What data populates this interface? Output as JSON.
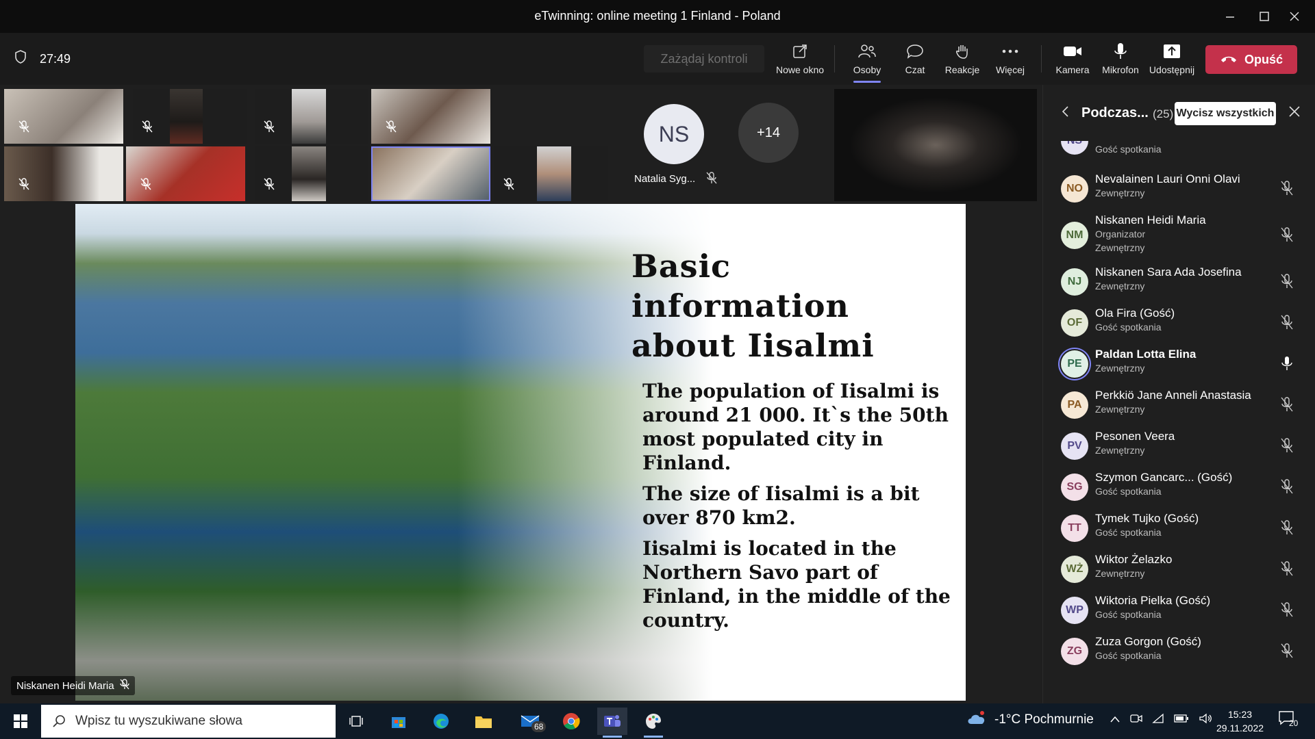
{
  "window": {
    "title": "eTwinning: online meeting 1 Finland - Poland"
  },
  "toolbar": {
    "timer": "27:49",
    "request_control": "Zażądaj kontroli",
    "new_window": "Nowe okno",
    "people": "Osoby",
    "chat": "Czat",
    "reactions": "Reakcje",
    "more": "Więcej",
    "camera": "Kamera",
    "mic": "Mikrofon",
    "share": "Udostępnij",
    "leave": "Opuść"
  },
  "gallery": {
    "ns_initials": "NS",
    "ns_name": "Natalia Syg...",
    "overflow": "+14"
  },
  "slide": {
    "title": "Basic information about Iisalmi",
    "paragraphs": [
      "The population of Iisalmi is around 21 000. It`s the 50th most populated city in Finland.",
      "The size of Iisalmi is a bit over 870 km2.",
      "Iisalmi is located in the Northern Savo part of Finland, in the middle of the country."
    ]
  },
  "presenter": {
    "name": "Niskanen Heidi Maria"
  },
  "panel": {
    "title": "Podczas...",
    "count": "(25)",
    "mute_all": "Wycisz wszystkich",
    "participants": [
      {
        "initials": "NO",
        "name": "Nevalainen Lauri Onni Olavi",
        "role": "Zewnętrzny",
        "role2": "",
        "bg": "#f5e6d3",
        "fg": "#8a5a23"
      },
      {
        "initials": "NM",
        "name": "Niskanen Heidi Maria",
        "role": "Organizator",
        "role2": "Zewnętrzny",
        "bg": "#e3eedc",
        "fg": "#4e6b3a"
      },
      {
        "initials": "NJ",
        "name": "Niskanen Sara Ada Josefina",
        "role": "Zewnętrzny",
        "role2": "",
        "bg": "#dfeede",
        "fg": "#3f6b3d"
      },
      {
        "initials": "OF",
        "name": "Ola Fira (Gość)",
        "role": "Gość spotkania",
        "role2": "",
        "bg": "#e5ead9",
        "fg": "#5b6b36"
      },
      {
        "initials": "PE",
        "name": "Paldan Lotta Elina",
        "role": "Zewnętrzny",
        "role2": "",
        "bg": "#e0f0e6",
        "fg": "#2f6b4d"
      },
      {
        "initials": "PA",
        "name": "Perkkiö Jane Anneli Anastasia",
        "role": "Zewnętrzny",
        "role2": "",
        "bg": "#f6e8d5",
        "fg": "#8a5a23"
      },
      {
        "initials": "PV",
        "name": "Pesonen Veera",
        "role": "Zewnętrzny",
        "role2": "",
        "bg": "#e6e3f3",
        "fg": "#534a8a"
      },
      {
        "initials": "SG",
        "name": "Szymon Gancarc... (Gość)",
        "role": "Gość spotkania",
        "role2": "",
        "bg": "#f3e0e8",
        "fg": "#8a3f5e"
      },
      {
        "initials": "TT",
        "name": "Tymek Tujko (Gość)",
        "role": "Gość spotkania",
        "role2": "",
        "bg": "#f3e0e8",
        "fg": "#8a3f5e"
      },
      {
        "initials": "WŻ",
        "name": "Wiktor Żelazko",
        "role": "Zewnętrzny",
        "role2": "",
        "bg": "#e5ead9",
        "fg": "#5b6b36"
      },
      {
        "initials": "WP",
        "name": "Wiktoria Pielka (Gość)",
        "role": "Gość spotkania",
        "role2": "",
        "bg": "#e6e3f3",
        "fg": "#534a8a"
      },
      {
        "initials": "ZG",
        "name": "Zuza Gorgon (Gość)",
        "role": "Gość spotkania",
        "role2": "",
        "bg": "#f3e0e8",
        "fg": "#8a3f5e"
      }
    ]
  },
  "taskbar": {
    "search_placeholder": "Wpisz tu wyszukiwane słowa",
    "mail_badge": "68",
    "weather": "-1°C  Pochmurnie",
    "time": "15:23",
    "date": "29.11.2022",
    "notifications": "20"
  }
}
